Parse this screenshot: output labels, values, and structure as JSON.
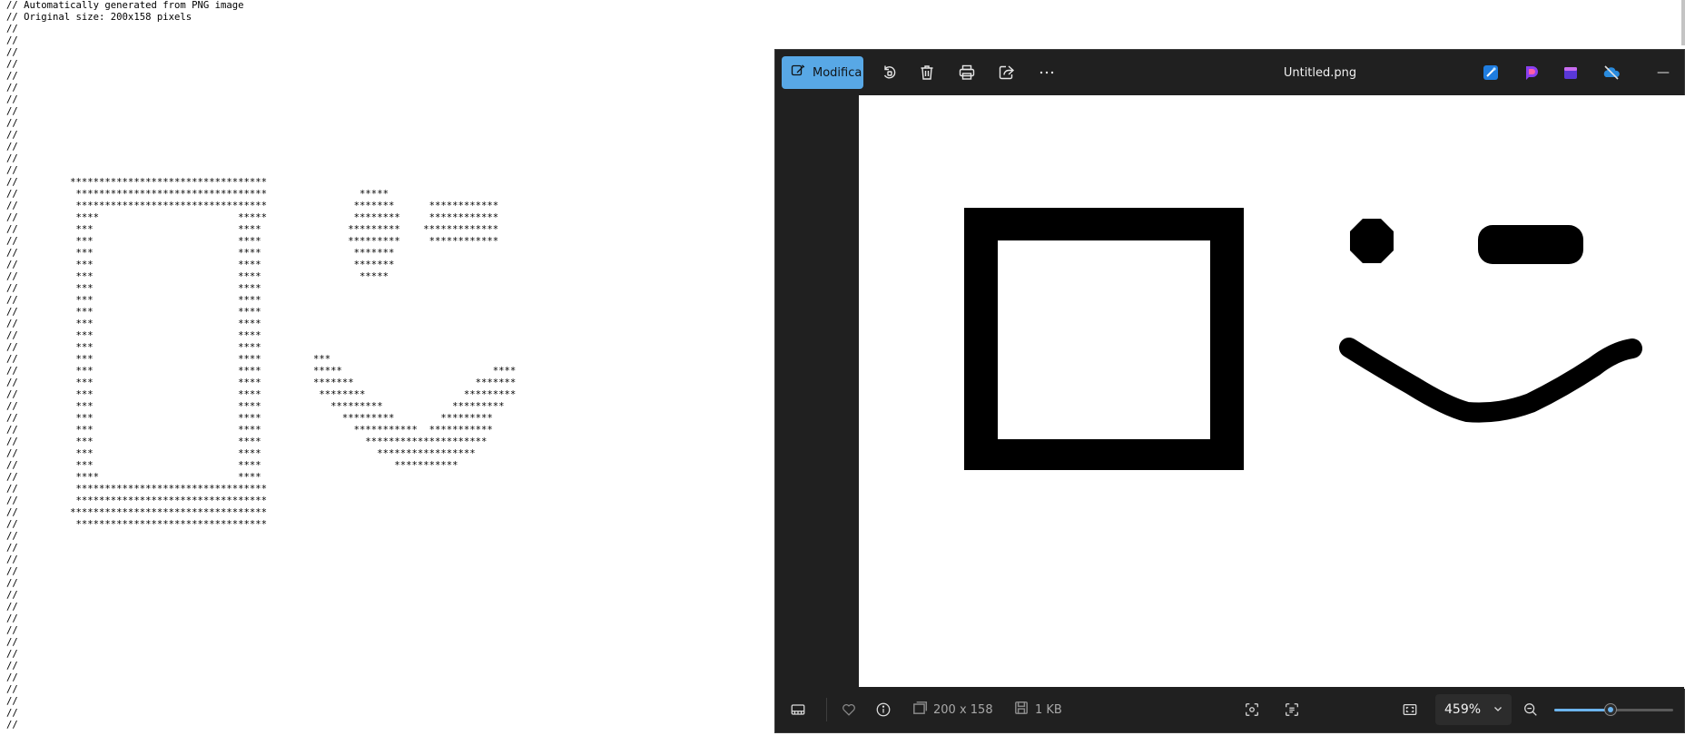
{
  "editor": {
    "ascii_art": "// Automatically generated from PNG image\n// Original size: 200x158 pixels\n//\n//\n//\n//\n//\n//\n//\n//\n//\n//\n//\n//\n//\n//         **********************************\n//          *********************************                *****\n//          *********************************               *******      ************\n//          ****                        *****               ********     ************\n//          ***                         ****               *********    *************\n//          ***                         ****               *********     ************\n//          ***                         ****                *******\n//          ***                         ****                *******\n//          ***                         ****                 *****\n//          ***                         ****\n//          ***                         ****\n//          ***                         ****\n//          ***                         ****\n//          ***                         ****\n//          ***                         ****\n//          ***                         ****         ***\n//          ***                         ****         *****                          ****\n//          ***                         ****         *******                     *******\n//          ***                         ****          ********                 *********\n//          ***                         ****            *********            *********\n//          ***                         ****              *********        *********\n//          ***                         ****                ***********  ***********\n//          ***                         ****                  *********************\n//          ***                         ****                    *****************\n//          ***                         ****                       ***********\n//          ****                        ****\n//          *********************************\n//          *********************************\n//         **********************************\n//          *********************************\n//\n//\n//\n//\n//\n//\n//\n//\n//\n//\n//\n//\n//\n//\n//\n//\n//"
  },
  "viewer": {
    "edit_button_label": "Modifica",
    "filename": "Untitled.png",
    "minimize_glyph": "—",
    "toolbar_icons": [
      "edit-icon",
      "rotate-icon",
      "delete-icon",
      "print-icon",
      "share-icon",
      "more-icon"
    ],
    "app_icons": [
      "photo-edit-app-icon",
      "designer-app-icon",
      "clipchamp-app-icon",
      "onedrive-icon"
    ],
    "status": {
      "dimensions": "200 x 158",
      "file_size": "1 KB",
      "zoom": "459%",
      "zoom_slider_level": 0.47
    },
    "accent_color": "#58a8e6"
  }
}
